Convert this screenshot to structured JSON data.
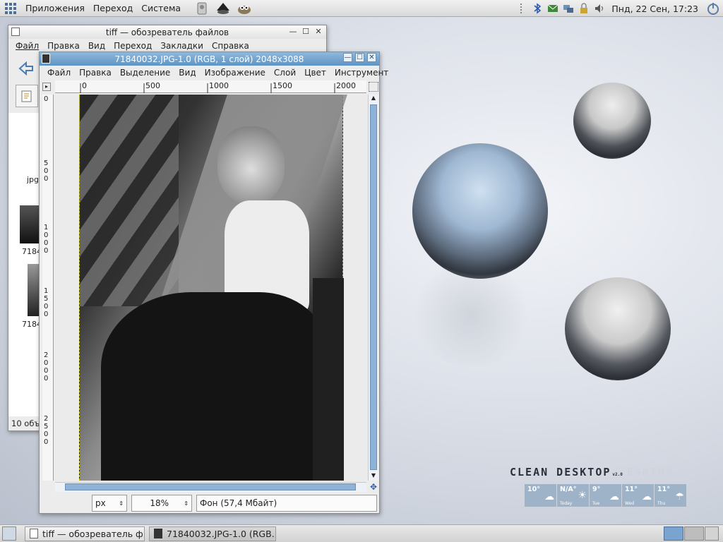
{
  "top_panel": {
    "menus": [
      "Приложения",
      "Переход",
      "Система"
    ],
    "clock": "Пнд, 22 Сен, 17:23"
  },
  "file_browser": {
    "title": "tiff — обозреватель файлов",
    "menus": [
      "Файл",
      "Правка",
      "Вид",
      "Переход",
      "Закладки",
      "Справка"
    ],
    "items": [
      "jpg",
      "7184",
      "7184"
    ],
    "status": "10 объ"
  },
  "gimp": {
    "title": "71840032.JPG-1.0 (RGB, 1 слой) 2048x3088",
    "menus": [
      "Файл",
      "Правка",
      "Выделение",
      "Вид",
      "Изображение",
      "Слой",
      "Цвет",
      "Инструмент"
    ],
    "ruler_h": [
      "0",
      "500",
      "1000",
      "1500",
      "2000"
    ],
    "ruler_v": [
      "0",
      "5\n0\n0",
      "1\n0\n0\n0",
      "1\n5\n0\n0",
      "2\n0\n0\n0",
      "2\n5\n0\n0"
    ],
    "unit": "px",
    "zoom": "18%",
    "layer_status": "Фон (57,4 Мбайт)"
  },
  "taskbar": {
    "tasks": [
      "tiff — обозреватель ф...",
      "71840032.JPG-1.0 (RGB..."
    ]
  },
  "desktop": {
    "logo": "CLEAN DESKTOP",
    "logo_ver": "v2.0",
    "logo_ghost": "ESKTOP",
    "weather": [
      {
        "temp": "10°",
        "day": "Today"
      },
      {
        "temp": "N/A°",
        "day": "Today"
      },
      {
        "temp": "9°",
        "day": "Tue"
      },
      {
        "temp": "11°",
        "day": "Wed"
      },
      {
        "temp": "11°",
        "day": "Thu"
      }
    ]
  },
  "colors": {
    "gimp_title": "#6b9ccb",
    "desktop": "#dde1e9",
    "weather_bg": "#9fb3c8"
  }
}
